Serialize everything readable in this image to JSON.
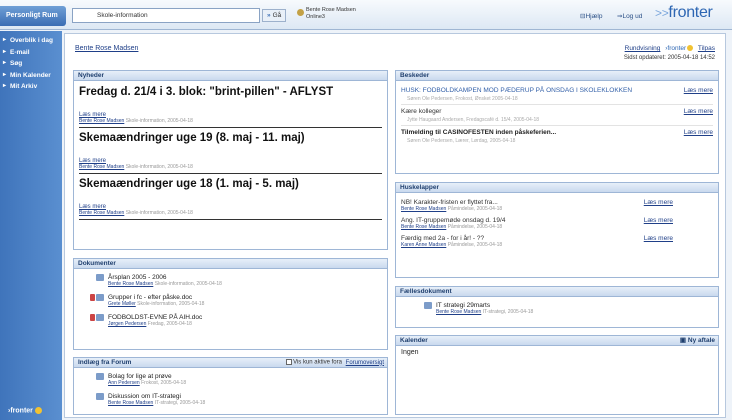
{
  "topbar": {
    "room_tab": "Personligt Rum",
    "room_select": "Skole-information",
    "go_label": "Gå",
    "online_user": "Bente Rose Madsen",
    "online_status": "Online3",
    "help_label": "Hjælp",
    "logout_label": "Log ud",
    "brand": "fronter"
  },
  "sidebar": {
    "items": [
      {
        "label": "Overblik i dag"
      },
      {
        "label": "E-mail"
      },
      {
        "label": "Søg"
      },
      {
        "label": "Min Kalender"
      },
      {
        "label": "Mit Arkiv"
      }
    ],
    "footer_brand": "fronter"
  },
  "header": {
    "user_link": "Bente Rose Madsen",
    "rundvisning": "Rundvisning",
    "fronter_small": "fronter",
    "tilpas": "Tilpas",
    "updated": "Sidst opdateret: 2005-04-18 14:52"
  },
  "nyheder": {
    "title": "Nyheder",
    "items": [
      {
        "headline": "Fredag d. 21/4 i 3. blok: \"brint-pillen\" - AFLYST",
        "read_more": "Læs mere",
        "author": "Bente Rose Madsen",
        "meta": "Skole-information, 2005-04-18"
      },
      {
        "headline": "Skemaændringer uge 19 (8. maj - 11. maj)",
        "read_more": "Læs mere",
        "author": "Bente Rose Madsen",
        "meta": "Skole-information, 2005-04-18"
      },
      {
        "headline": "Skemaændringer uge 18 (1. maj - 5. maj)",
        "read_more": "Læs mere",
        "author": "Bente Rose Madsen",
        "meta": "Skole-information, 2005-04-18"
      }
    ]
  },
  "dokumenter": {
    "title": "Dokumenter",
    "items": [
      {
        "name": "Årsplan 2005 - 2006",
        "author": "Bente Rose Madsen",
        "meta": "Skole-information, 2005-04-18"
      },
      {
        "name": "Grupper i fc - efter påske.doc",
        "author": "Grete Møller",
        "meta": "Skole-information, 2005-04-18"
      },
      {
        "name": "FODBOLDST-EVNE PÅ AIH.doc",
        "author": "Jørgen Pedersen",
        "meta": "Fredag, 2005-04-18"
      }
    ]
  },
  "forum": {
    "title": "Indlæg fra Forum",
    "only_active": "Vis kun aktive fora",
    "overview": "Forumoversigt",
    "items": [
      {
        "name": "Bolag for lige at prøve",
        "author": "Ann Pedersen",
        "meta": "Frokost, 2005-04-18"
      },
      {
        "name": "Diskussion om IT-strategi",
        "author": "Bente Rose Madsen",
        "meta": "IT-strategi, 2005-04-18"
      }
    ]
  },
  "beskeder": {
    "title": "Beskeder",
    "items": [
      {
        "text": "HUSK: FODBOLDKAMPEN MOD PÆDERUP PÅ ONSDAG I SKOLEKLOKKEN",
        "meta": "Søren Ole Pedersen, Frokost, Ønsket 2005-04-18",
        "link": "Læs mere",
        "style": "blue"
      },
      {
        "text": "Kære kolleger",
        "meta": "Jytte Haugaard Andersen, Fredagscafé d. 15/4, 2005-04-18",
        "link": "Læs mere",
        "style": "plain"
      },
      {
        "text": "Tilmelding til CASINOFESTEN inden påskeferien...",
        "meta": "Søren Ole Pedersen, Lærer, Lørdag, 2005-04-18",
        "link": "Læs mere",
        "style": "bold"
      }
    ]
  },
  "huskelapper": {
    "title": "Huskelapper",
    "items": [
      {
        "text": "NB! Karakter-fristen er flyttet fra...",
        "author": "Bente Rose Madsen",
        "meta": "Påmindelse, 2005-04-18",
        "link": "Læs mere"
      },
      {
        "text": "Ang. IT-gruppemøde onsdag d. 19/4",
        "author": "Bente Rose Madsen",
        "meta": "Påmindelse, 2005-04-18",
        "link": "Læs mere"
      },
      {
        "text": "Færdig med 2a - for i år! - ??",
        "author": "Karen Anne Madsen",
        "meta": "Påmindelse, 2005-04-18",
        "link": "Læs mere"
      }
    ]
  },
  "faellesdokument": {
    "title": "Fællesdokument",
    "items": [
      {
        "name": "IT strategi 29marts",
        "author": "Bente Rose Madsen",
        "meta": "IT-strategi, 2005-04-18"
      }
    ]
  },
  "kalender": {
    "title": "Kalender",
    "new_label": "Ny aftale",
    "empty": "Ingen"
  }
}
